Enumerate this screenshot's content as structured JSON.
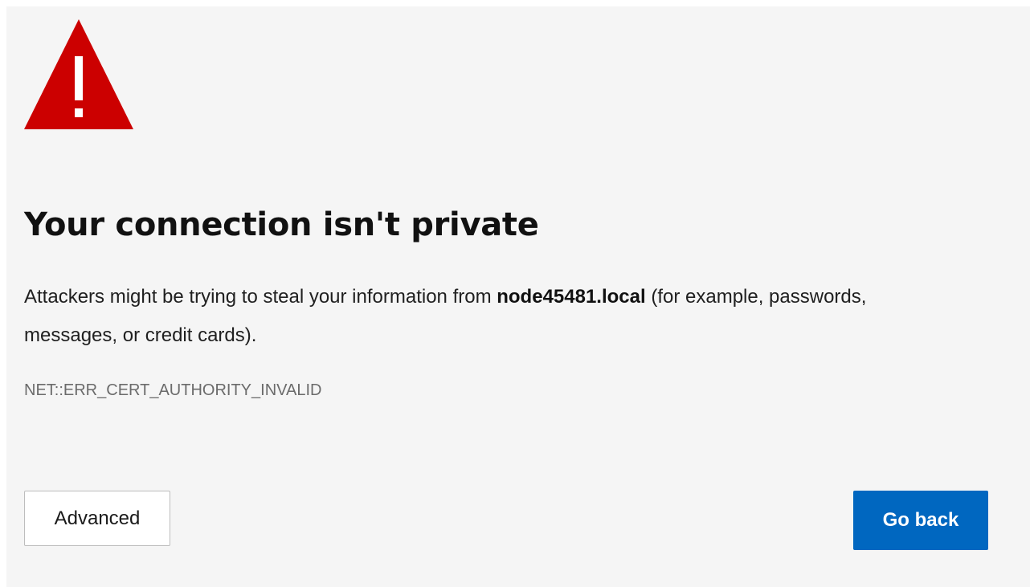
{
  "icons": {
    "warning": "warning-triangle-icon",
    "warning_color": "#cc0000"
  },
  "colors": {
    "background": "#f5f5f5",
    "primary_button": "#0067c0"
  },
  "error_page": {
    "title": "Your connection isn't private",
    "message_before": "Attackers might be trying to steal your information from ",
    "host": "node45481.local",
    "message_after": " (for example, passwords, messages, or credit cards).",
    "error_code": "NET::ERR_CERT_AUTHORITY_INVALID"
  },
  "buttons": {
    "advanced_label": "Advanced",
    "go_back_label": "Go back"
  }
}
